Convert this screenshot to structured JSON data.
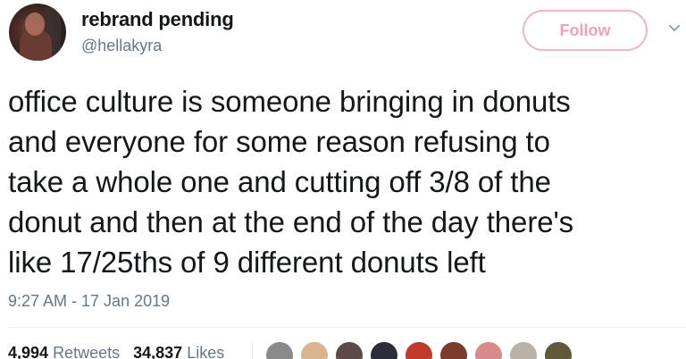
{
  "user": {
    "display_name": "rebrand pending",
    "handle": "@hellakyra"
  },
  "follow_button": {
    "label": "Follow"
  },
  "tweet": {
    "lines": [
      "office culture is someone bringing in donuts",
      "and everyone for some reason refusing to",
      "take a whole one and cutting off 3/8 of the",
      "donut and then at the end of the day there's",
      "like 17/25ths of 9 different donuts left"
    ],
    "timestamp": "9:27 AM - 17 Jan 2019"
  },
  "stats": {
    "retweets_count": "4,994",
    "retweets_label": "Retweets",
    "likes_count": "34,837",
    "likes_label": "Likes"
  },
  "likers": [
    {
      "name": "liker-1",
      "color": "#8a8a8a"
    },
    {
      "name": "liker-2",
      "color": "#d9b48f"
    },
    {
      "name": "liker-3",
      "color": "#5b4a45"
    },
    {
      "name": "liker-4",
      "color": "#2d2d3a"
    },
    {
      "name": "liker-5",
      "color": "#c0392b"
    },
    {
      "name": "liker-6",
      "color": "#7a3d2c"
    },
    {
      "name": "liker-7",
      "color": "#d88b8b"
    },
    {
      "name": "liker-8",
      "color": "#b9b2a6"
    },
    {
      "name": "liker-9",
      "color": "#5e5a3a"
    }
  ],
  "colors": {
    "follow_accent": "#f0a2b3",
    "secondary_text": "#657786",
    "primary_text": "#14171a"
  }
}
